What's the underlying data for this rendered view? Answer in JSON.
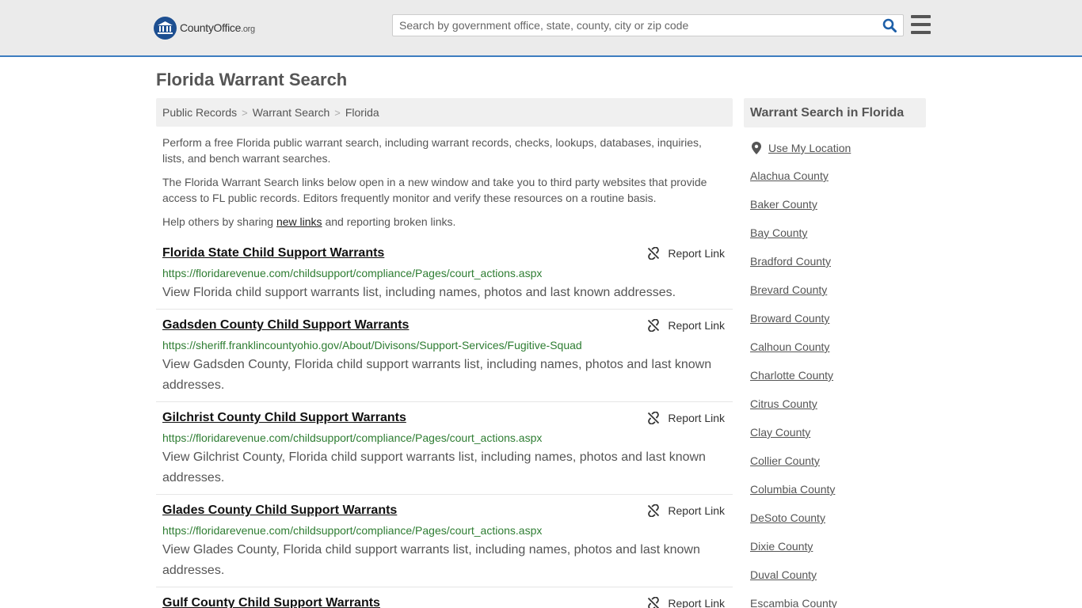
{
  "header": {
    "logo_text_main": "CountyOffice",
    "logo_text_tld": ".org",
    "search_placeholder": "Search by government office, state, county, city or zip code"
  },
  "page_title": "Florida Warrant Search",
  "breadcrumb": [
    "Public Records",
    "Warrant Search",
    "Florida"
  ],
  "intro": {
    "p1": "Perform a free Florida public warrant search, including warrant records, checks, lookups, databases, inquiries, lists, and bench warrant searches.",
    "p2": "The Florida Warrant Search links below open in a new window and take you to third party websites that provide access to FL public records. Editors frequently monitor and verify these resources on a routine basis.",
    "p3_before": "Help others by sharing ",
    "p3_link": "new links",
    "p3_after": " and reporting broken links."
  },
  "report_label": "Report Link",
  "results": [
    {
      "title": "Florida State Child Support Warrants",
      "url": "https://floridarevenue.com/childsupport/compliance/Pages/court_actions.aspx",
      "desc": "View Florida child support warrants list, including names, photos and last known addresses."
    },
    {
      "title": "Gadsden County Child Support Warrants",
      "url": "https://sheriff.franklincountyohio.gov/About/Divisons/Support-Services/Fugitive-Squad",
      "desc": "View Gadsden County, Florida child support warrants list, including names, photos and last known addresses."
    },
    {
      "title": "Gilchrist County Child Support Warrants",
      "url": "https://floridarevenue.com/childsupport/compliance/Pages/court_actions.aspx",
      "desc": "View Gilchrist County, Florida child support warrants list, including names, photos and last known addresses."
    },
    {
      "title": "Glades County Child Support Warrants",
      "url": "https://floridarevenue.com/childsupport/compliance/Pages/court_actions.aspx",
      "desc": "View Glades County, Florida child support warrants list, including names, photos and last known addresses."
    },
    {
      "title": "Gulf County Child Support Warrants",
      "url": "",
      "desc": ""
    }
  ],
  "sidebar": {
    "heading": "Warrant Search in Florida",
    "use_location": "Use My Location",
    "counties": [
      "Alachua County",
      "Baker County",
      "Bay County",
      "Bradford County",
      "Brevard County",
      "Broward County",
      "Calhoun County",
      "Charlotte County",
      "Citrus County",
      "Clay County",
      "Collier County",
      "Columbia County",
      "DeSoto County",
      "Dixie County",
      "Duval County",
      "Escambia County"
    ]
  },
  "colors": {
    "accent": "#3d7dbf",
    "logo_blue": "#1d4f91",
    "url_green": "#2e7d32"
  },
  "icons": [
    "search-icon",
    "menu-icon",
    "broken-link-icon",
    "location-pin-icon",
    "logo-badge-icon"
  ]
}
